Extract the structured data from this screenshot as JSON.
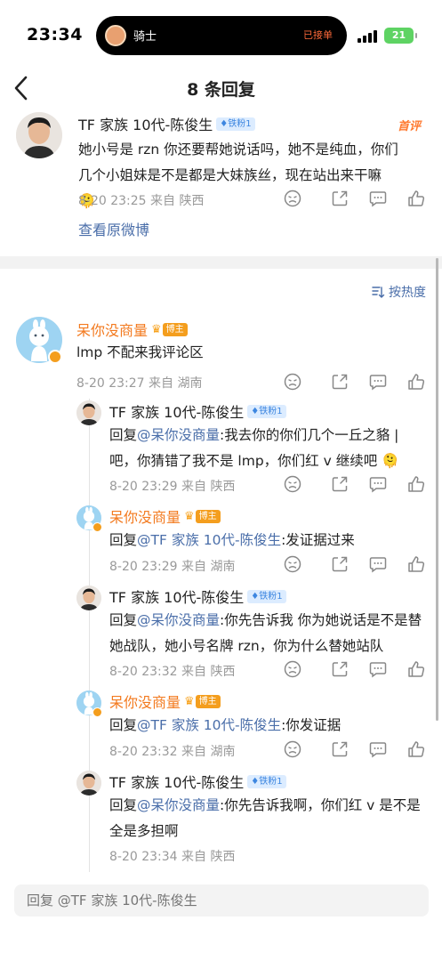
{
  "status_bar": {
    "time": "23:34",
    "island_label": "骑士",
    "island_status": "已接单",
    "battery": "21"
  },
  "header": {
    "title": "8 条回复"
  },
  "root": {
    "name": "TF 家族 10代-陈俊生",
    "badge": "铁粉1",
    "stamp": "首评",
    "text": "她小号是 rzn 你还要帮她说话吗，她不是纯血，你们几个小姐妹是不是都是大妹族丝，现在站出来干嘛 🫠",
    "meta": "8-20 23:25 来自 陕西",
    "view_original": "查看原微博"
  },
  "sort_label": "按热度",
  "main_comment": {
    "name": "呆你没商量",
    "badge": "博主",
    "text": "lmp 不配来我评论区",
    "meta": "8-20 23:27 来自 湖南"
  },
  "replies": [
    {
      "name": "TF 家族 10代-陈俊生",
      "badge": "铁粉1",
      "prefix": "回复",
      "mention": "@呆你没商量",
      "text": ":我去你的你们几个一丘之貉 | 吧，你猜错了我不是 lmp，你们红 v 继续吧 🫠",
      "meta": "8-20 23:29 来自 陕西"
    },
    {
      "name": "呆你没商量",
      "badge": "博主",
      "prefix": "回复",
      "mention": "@TF 家族 10代-陈俊生",
      "text": ":发证据过来",
      "meta": "8-20 23:29 来自 湖南"
    },
    {
      "name": "TF 家族 10代-陈俊生",
      "badge": "铁粉1",
      "prefix": "回复",
      "mention": "@呆你没商量",
      "text": ":你先告诉我 你为她说话是不是替她战队，她小号名牌 rzn，你为什么替她站队",
      "meta": "8-20 23:32 来自 陕西"
    },
    {
      "name": "呆你没商量",
      "badge": "博主",
      "prefix": "回复",
      "mention": "@TF 家族 10代-陈俊生",
      "text": ":你发证据",
      "meta": "8-20 23:32 来自 湖南"
    },
    {
      "name": "TF 家族 10代-陈俊生",
      "badge": "铁粉1",
      "prefix": "回复",
      "mention": "@呆你没商量",
      "text": ":你先告诉我啊，你们红 v 是不是全是多担啊",
      "meta": "8-20 23:34 来自 陕西"
    }
  ],
  "reply_input": {
    "placeholder": "回复 @TF 家族 10代-陈俊生"
  }
}
